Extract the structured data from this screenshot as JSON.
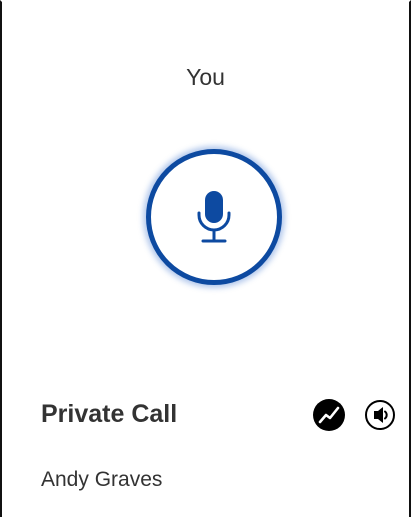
{
  "call": {
    "speaker_label": "You",
    "call_type": "Private Call",
    "caller_name": "Andy Graves"
  },
  "icons": {
    "microphone": "microphone-icon",
    "signal": "signal-strength-icon",
    "speaker": "speaker-icon"
  },
  "colors": {
    "accent": "#0d4aa1",
    "text": "#333333",
    "frame": "#111111"
  }
}
